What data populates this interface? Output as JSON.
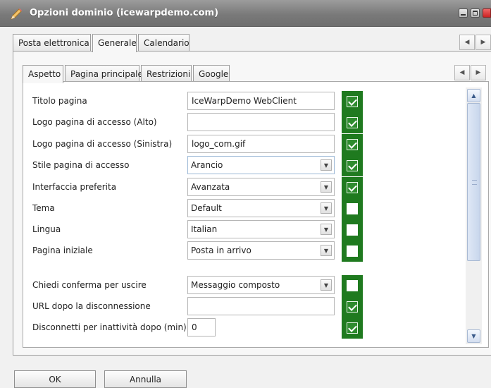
{
  "window": {
    "title": "Opzioni dominio (icewarpdemo.com)",
    "icon": "pencil-icon"
  },
  "outer_tabs": [
    {
      "label": "Posta elettronica",
      "active": false
    },
    {
      "label": "Generale",
      "active": true
    },
    {
      "label": "Calendario",
      "active": false
    }
  ],
  "inner_tabs": [
    {
      "label": "Aspetto",
      "active": true
    },
    {
      "label": "Pagina principale",
      "active": false
    },
    {
      "label": "Restrizioni",
      "active": false
    },
    {
      "label": "Google",
      "active": false
    }
  ],
  "nav": {
    "prev": "◀",
    "next": "▶"
  },
  "fields": [
    {
      "label": "Titolo pagina",
      "type": "text",
      "value": "IceWarpDemo WebClient",
      "checked": true
    },
    {
      "label": "Logo pagina di accesso (Alto)",
      "type": "text",
      "value": "",
      "checked": true
    },
    {
      "label": "Logo pagina di accesso (Sinistra)",
      "type": "text",
      "value": "logo_com.gif",
      "checked": true
    },
    {
      "label": "Stile pagina di accesso",
      "type": "select",
      "value": "Arancio",
      "checked": true
    },
    {
      "label": "Interfaccia preferita",
      "type": "select",
      "value": "Avanzata",
      "checked": true
    },
    {
      "label": "Tema",
      "type": "select",
      "value": "Default",
      "checked": false
    },
    {
      "label": "Lingua",
      "type": "select",
      "value": "Italian",
      "checked": false
    },
    {
      "label": "Pagina iniziale",
      "type": "select",
      "value": "Posta in arrivo",
      "checked": false
    },
    {
      "label": "Chiedi conferma per uscire",
      "type": "select",
      "value": "Messaggio composto",
      "checked": false
    },
    {
      "label": "URL dopo la disconnessione",
      "type": "text",
      "value": "",
      "checked": true
    },
    {
      "label": "Disconnetti per inattività dopo (min)",
      "type": "text",
      "value": "0",
      "checked": true
    }
  ],
  "buttons": {
    "ok": "OK",
    "cancel": "Annulla"
  },
  "colors": {
    "checkbox_bg": "#1f7a1f",
    "titlebar": "#7a7a7a"
  }
}
